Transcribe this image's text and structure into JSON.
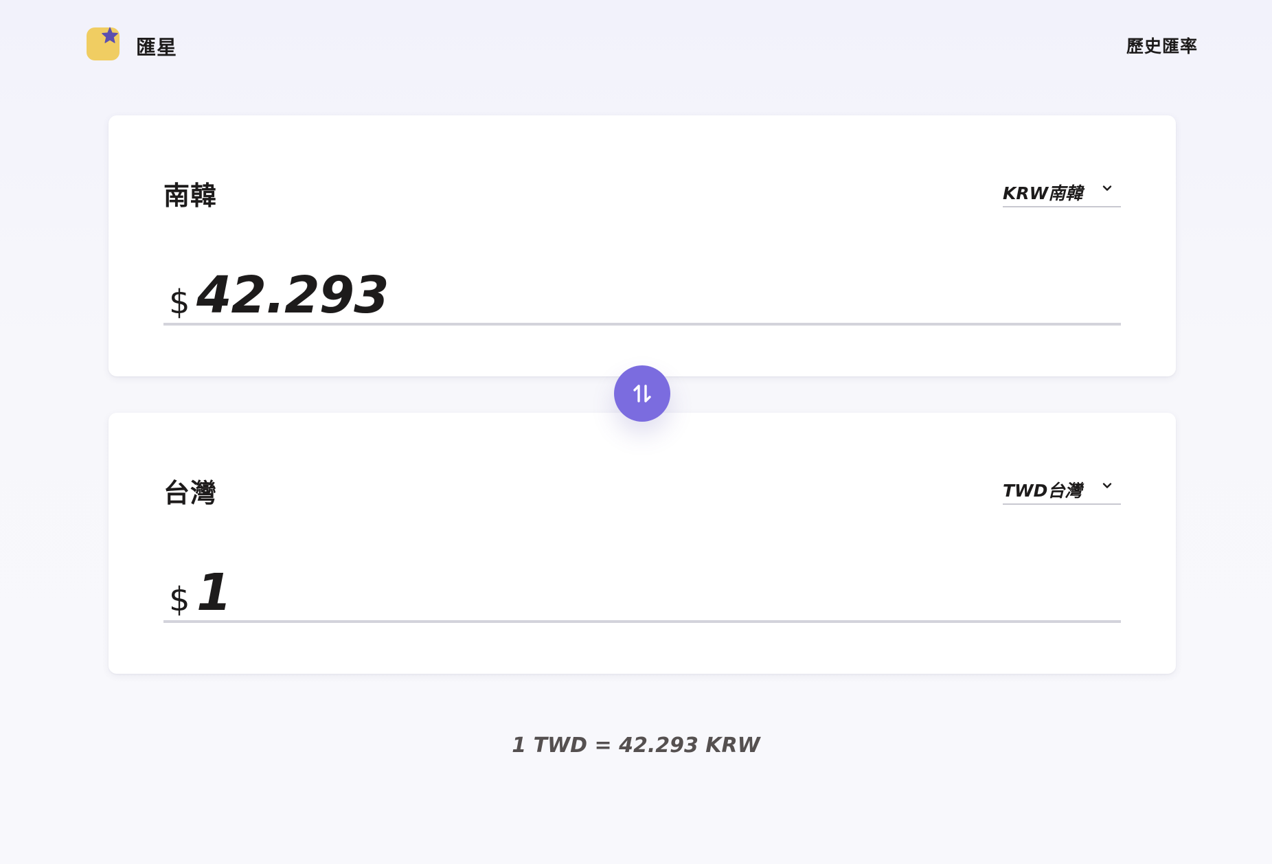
{
  "app": {
    "brand_name": "匯星",
    "logo_icon": "star-note-logo-icon"
  },
  "nav": {
    "history_label": "歷史匯率"
  },
  "from_card": {
    "title": "南韓",
    "currency_option": "KRW南韓",
    "currency_symbol": "$",
    "amount": "42.293"
  },
  "to_card": {
    "title": "台灣",
    "currency_option": "TWD台灣",
    "currency_symbol": "$",
    "amount": "1"
  },
  "swap": {
    "icon": "swap-vertical-icon",
    "color": "#7b6cdf"
  },
  "rate": {
    "text": "1 TWD = 42.293 KRW"
  },
  "colors": {
    "accent": "#7b6cdf",
    "logo_yellow": "#f0cd62",
    "logo_star": "#5b4fb0"
  }
}
